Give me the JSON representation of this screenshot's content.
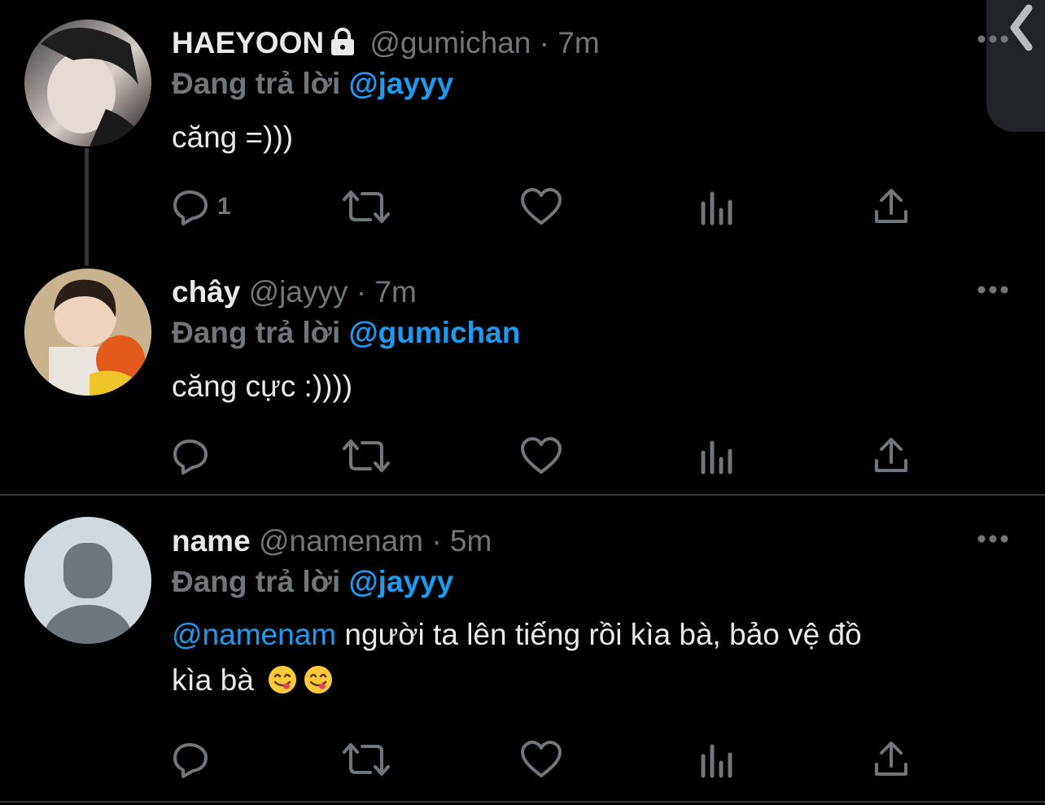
{
  "tweets": [
    {
      "display_name": "HAEYOON",
      "handle": "@gumichan",
      "dot": "·",
      "time": "7m",
      "reply_prefix": "Đang trả lời",
      "reply_to": "@jayyy",
      "text": "căng =)))",
      "reply_count": "1",
      "locked": true
    },
    {
      "display_name": "chây",
      "handle": "@jayyy",
      "dot": "·",
      "time": "7m",
      "reply_prefix": "Đang trả lời",
      "reply_to": "@gumichan",
      "text": "căng cực :))))",
      "reply_count": ""
    },
    {
      "display_name": "name",
      "handle": "@namenam",
      "dot": "·",
      "time": "5m",
      "reply_prefix": "Đang trả lời",
      "reply_to": "@jayyy",
      "text_mention": "@namenam",
      "text_line1": " người ta lên tiếng rồi kìa bà, bảo vệ đồ",
      "text_line2": "kìa bà",
      "emojis": [
        "face-savoring-food-emoji",
        "face-savoring-food-emoji"
      ],
      "reply_count": ""
    }
  ],
  "icons": {
    "reply": "reply-icon",
    "retweet": "retweet-icon",
    "like": "heart-icon",
    "views": "views-icon",
    "share": "share-icon",
    "more": "more-icon",
    "lock": "lock-icon"
  },
  "colors": {
    "background": "#000000",
    "text": "#e7e9ea",
    "secondary": "#71767b",
    "accent": "#1d9bf0"
  }
}
